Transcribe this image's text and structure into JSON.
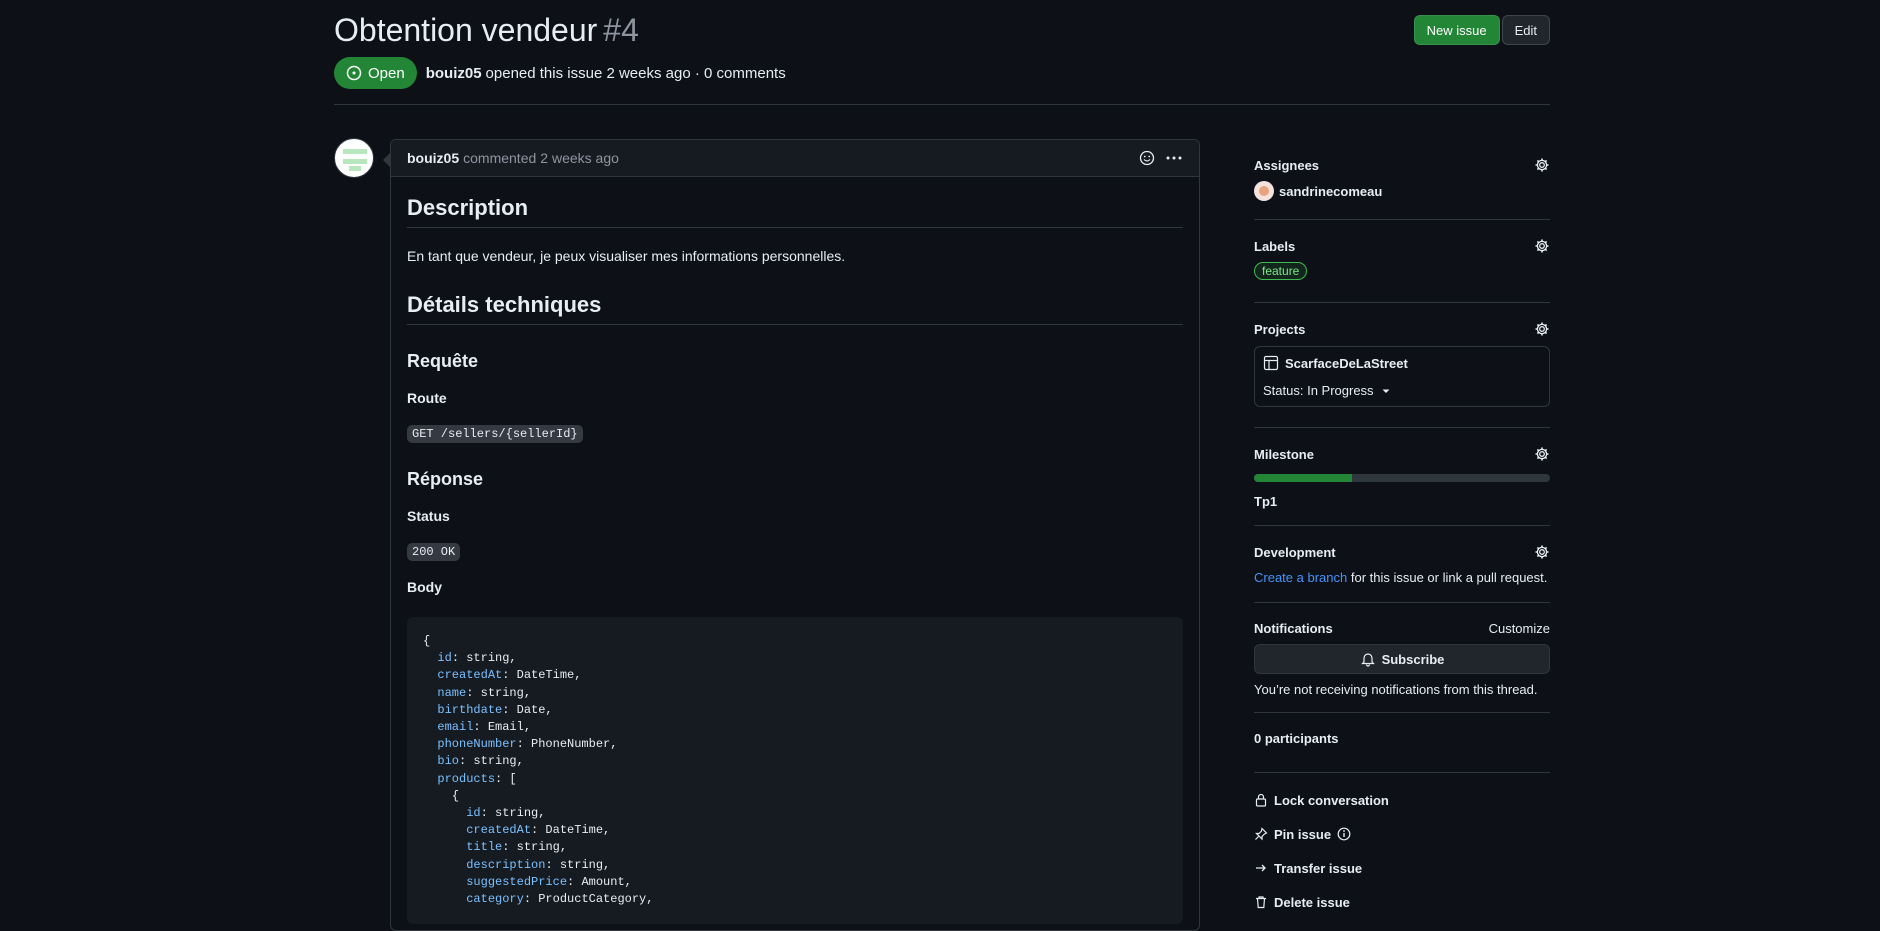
{
  "issue": {
    "title": "Obtention vendeur",
    "number": "#4",
    "state": "Open",
    "author": "bouiz05",
    "opened_text": "opened this issue 2 weeks ago · 0 comments"
  },
  "header_buttons": {
    "new_issue": "New issue",
    "edit": "Edit"
  },
  "comment": {
    "author": "bouiz05",
    "action": "commented",
    "time": "2 weeks ago",
    "h_description": "Description",
    "description": "En tant que vendeur, je peux visualiser mes informations personnelles.",
    "h_tech": "Détails techniques",
    "h_request": "Requête",
    "h_route": "Route",
    "route": "GET /sellers/{sellerId}",
    "h_response": "Réponse",
    "h_status": "Status",
    "status": "200 OK",
    "h_body": "Body",
    "body_lines": [
      [
        "",
        "{",
        ""
      ],
      [
        "  ",
        "id",
        ": string,"
      ],
      [
        "  ",
        "createdAt",
        ": DateTime,"
      ],
      [
        "  ",
        "name",
        ": string,"
      ],
      [
        "  ",
        "birthdate",
        ": Date,"
      ],
      [
        "  ",
        "email",
        ": Email,"
      ],
      [
        "  ",
        "phoneNumber",
        ": PhoneNumber,"
      ],
      [
        "  ",
        "bio",
        ": string,"
      ],
      [
        "  ",
        "products",
        ": ["
      ],
      [
        "    ",
        "{",
        ""
      ],
      [
        "      ",
        "id",
        ": string,"
      ],
      [
        "      ",
        "createdAt",
        ": DateTime,"
      ],
      [
        "      ",
        "title",
        ": string,"
      ],
      [
        "      ",
        "description",
        ": string,"
      ],
      [
        "      ",
        "suggestedPrice",
        ": Amount,"
      ],
      [
        "      ",
        "category",
        ": ProductCategory,"
      ]
    ]
  },
  "sidebar": {
    "assignees_title": "Assignees",
    "assignee": "sandrinecomeau",
    "labels_title": "Labels",
    "label": "feature",
    "projects_title": "Projects",
    "project_name": "ScarfaceDeLaStreet",
    "project_status": "Status: In Progress",
    "milestone_title": "Milestone",
    "milestone_progress": 0.33,
    "milestone_name": "Tp1",
    "development_title": "Development",
    "dev_link": "Create a branch",
    "dev_text": " for this issue or link a pull request.",
    "notifications_title": "Notifications",
    "customize": "Customize",
    "subscribe": "Subscribe",
    "notif_text": "You’re not receiving notifications from this thread.",
    "participants": "0 participants",
    "lock": "Lock conversation",
    "pin": "Pin issue",
    "transfer": "Transfer issue",
    "delete": "Delete issue"
  },
  "colors": {
    "accent_green": "#238636",
    "link": "#4493f8",
    "code_key": "#79c0ff"
  }
}
